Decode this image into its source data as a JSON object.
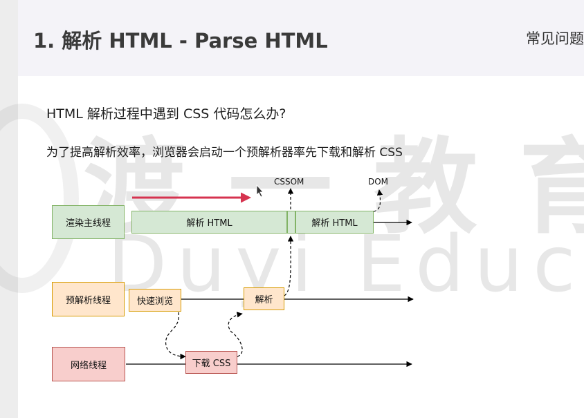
{
  "header": {
    "title": "1. 解析 HTML - Parse HTML",
    "corner_text": "常见问题"
  },
  "content": {
    "question": "HTML 解析过程中遇到 CSS 代码怎么办?",
    "answer": "为了提高解析效率，浏览器会启动一个预解析器率先下载和解析 CSS"
  },
  "watermark": {
    "cn": "渡一教育",
    "en": "Duyi Education"
  },
  "diagram": {
    "lanes": {
      "render": "渲染主线程",
      "preparse": "预解析线程",
      "network": "网络线程"
    },
    "blocks": {
      "parse_html_1": "解析 HTML",
      "parse_html_2": "解析 HTML",
      "quick_browse": "快速浏览",
      "parse": "解析",
      "download_css": "下载 CSS"
    },
    "outputs": {
      "cssom": "CSSOM",
      "dom": "DOM"
    },
    "colors": {
      "green_fill": "#d5e8d4",
      "green_stroke": "#82b366",
      "orange_fill": "#ffe6cc",
      "orange_stroke": "#d79b00",
      "red_fill": "#f8cecc",
      "red_stroke": "#b85450",
      "highlight_arrow": "#d6334f"
    }
  }
}
